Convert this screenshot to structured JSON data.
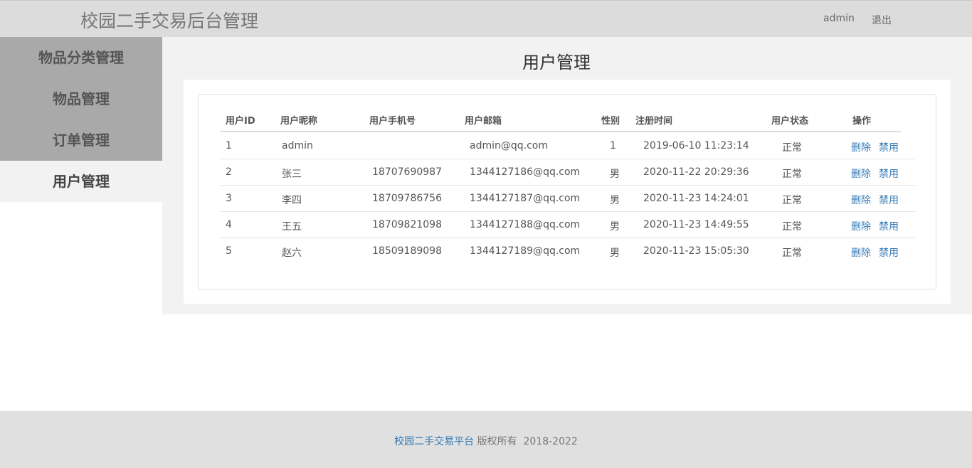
{
  "header": {
    "title": "校园二手交易后台管理",
    "user": "admin",
    "logout": "退出"
  },
  "sidebar": {
    "items": [
      {
        "label": "物品分类管理"
      },
      {
        "label": "物品管理"
      },
      {
        "label": "订单管理"
      },
      {
        "label": "用户管理",
        "active": true
      }
    ]
  },
  "main": {
    "title": "用户管理",
    "table": {
      "columns": [
        "用户ID",
        "用户昵称",
        "用户手机号",
        "用户邮箱",
        "性别",
        "注册时间",
        "用户状态",
        "操作"
      ],
      "rows": [
        {
          "id": "1",
          "nickname": "admin",
          "phone": "",
          "email": "admin@qq.com",
          "gender": "1",
          "registered": "2019-06-10 11:23:14",
          "status": "正常",
          "delete": "删除",
          "ban": "禁用"
        },
        {
          "id": "2",
          "nickname": "张三",
          "phone": "18707690987",
          "email": "1344127186@qq.com",
          "gender": "男",
          "registered": "2020-11-22 20:29:36",
          "status": "正常",
          "delete": "删除",
          "ban": "禁用"
        },
        {
          "id": "3",
          "nickname": "李四",
          "phone": "18709786756",
          "email": "1344127187@qq.com",
          "gender": "男",
          "registered": "2020-11-23 14:24:01",
          "status": "正常",
          "delete": "删除",
          "ban": "禁用"
        },
        {
          "id": "4",
          "nickname": "王五",
          "phone": "18709821098",
          "email": "1344127188@qq.com",
          "gender": "男",
          "registered": "2020-11-23 14:49:55",
          "status": "正常",
          "delete": "删除",
          "ban": "禁用"
        },
        {
          "id": "5",
          "nickname": "赵六",
          "phone": "18509189098",
          "email": "1344127189@qq.com",
          "gender": "男",
          "registered": "2020-11-23 15:05:30",
          "status": "正常",
          "delete": "删除",
          "ban": "禁用"
        }
      ]
    }
  },
  "footer": {
    "link": "校园二手交易平台",
    "text": " 版权所有  2018-2022"
  },
  "colors": {
    "link": "#337ab7",
    "topbar": "#dcdcdc",
    "sidebar": "#a9a9a9",
    "content_bg": "#f2f2f2"
  }
}
